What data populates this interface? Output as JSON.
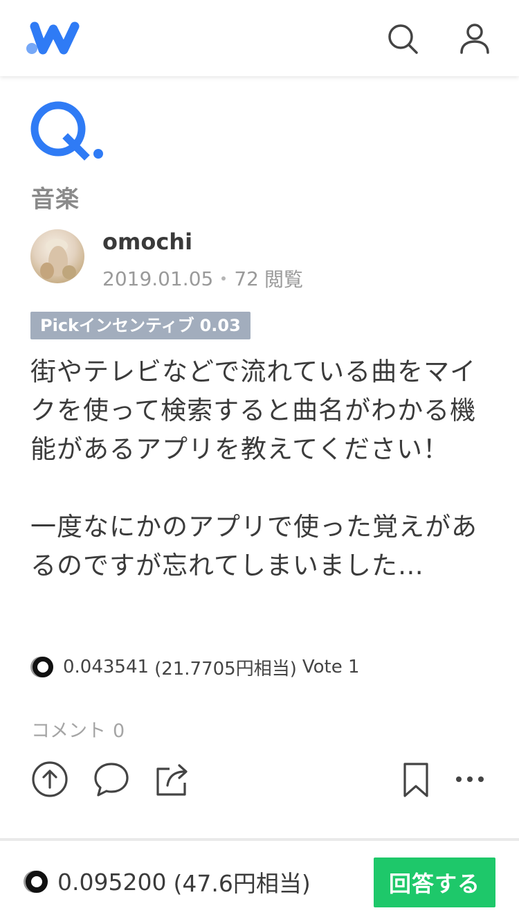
{
  "header": {
    "logo_icon": "w-logo-icon",
    "search_icon": "search-icon",
    "user_icon": "user-icon",
    "brand_color": "#2f7bf5",
    "dot_color": "#76a8f7"
  },
  "question": {
    "mark_icon": "q-mark-icon",
    "category": "音楽",
    "author": "omochi",
    "date": "2019.01.05",
    "views": "72",
    "views_label": "閲覧",
    "badge_label": "Pickインセンティブ",
    "badge_amount": "0.03",
    "badge_color": "#a2adbd",
    "body": [
      "街やテレビなどで流れている曲をマイクを使って検索すると曲名がわかる機能があるアプリを教えてください！",
      "一度なにかのアプリで使った覚えがあるのですが忘れてしまいました…"
    ],
    "reward_amount": "0.043541",
    "reward_yen": "(21.7705円相当)",
    "vote_label": "Vote 1",
    "comment_label": "コメント",
    "comment_count": "0"
  },
  "actions": {
    "vote_icon": "upvote-icon",
    "comment_icon": "comment-icon",
    "share_icon": "share-icon",
    "bookmark_icon": "bookmark-icon",
    "more_icon": "more-icon"
  },
  "footer": {
    "total_amount": "0.095200",
    "total_yen": "(47.6円相当)",
    "answer_button": "回答する",
    "answer_color": "#1ec86a"
  }
}
